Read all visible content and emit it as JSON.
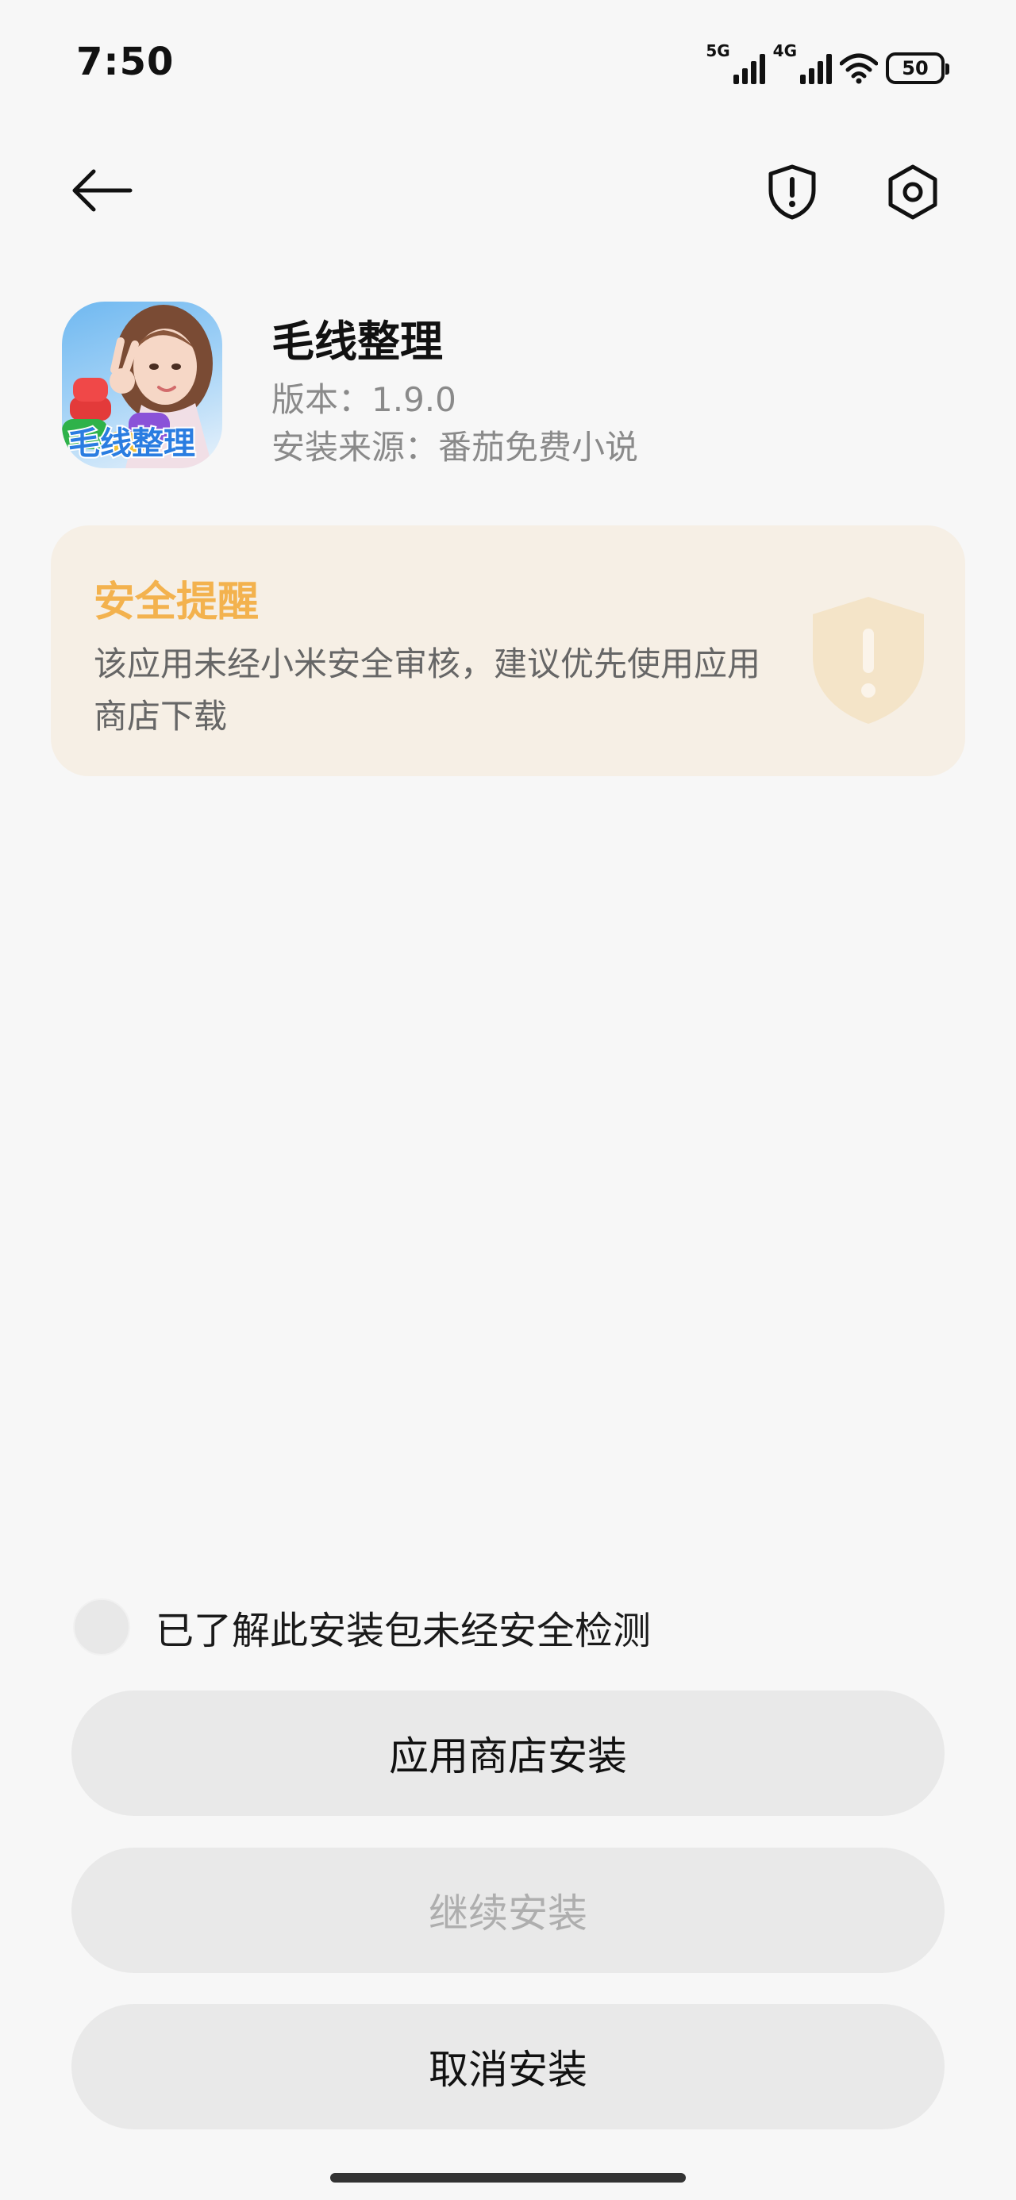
{
  "status_bar": {
    "time": "7:50",
    "net1": "5G",
    "net2": "4G",
    "battery": "50",
    "icons": [
      "signal-icon",
      "wifi-icon",
      "battery-icon"
    ]
  },
  "toolbar": {
    "icons": [
      "back-arrow-icon",
      "shield-alert-icon",
      "settings-icon"
    ]
  },
  "app": {
    "name": "毛线整理",
    "version": "版本：1.9.0",
    "source": "安装来源：番茄免费小说",
    "icon_text": "毛线整理"
  },
  "warning": {
    "title": "安全提醒",
    "text": "该应用未经小米安全审核，建议优先使用应用商店下载",
    "accent": "#f3b24e",
    "background": "#f6efe5"
  },
  "acknowledge": {
    "label": "已了解此安装包未经安全检测",
    "checked": false
  },
  "buttons": {
    "store_install": "应用商店安装",
    "continue_install": "继续安装",
    "cancel_install": "取消安装"
  }
}
